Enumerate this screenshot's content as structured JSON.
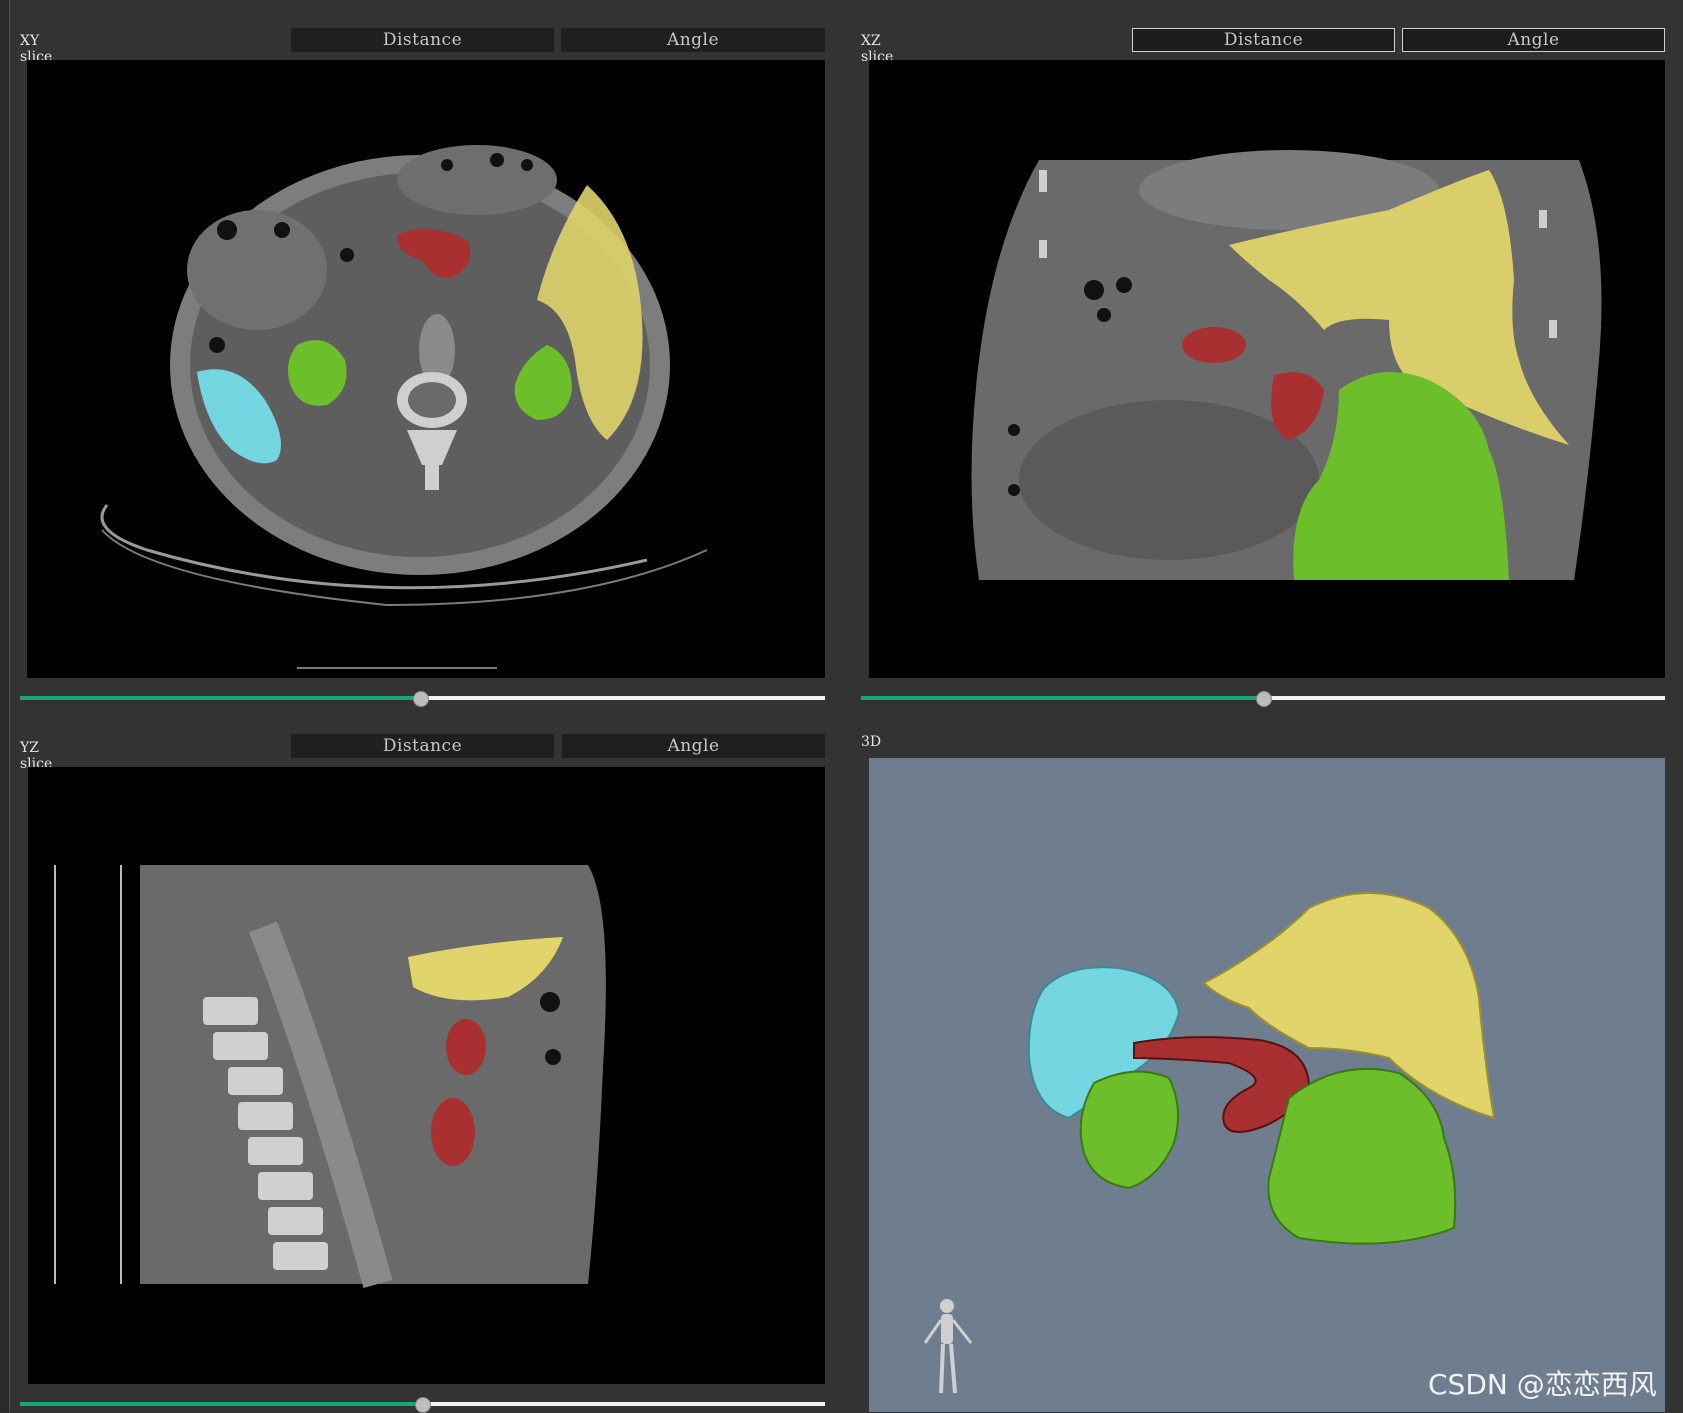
{
  "panels": {
    "xy": {
      "label": "XY slice",
      "distance": "Distance",
      "angle": "Angle",
      "slider": 0.5
    },
    "xz": {
      "label": "XZ slice",
      "distance": "Distance",
      "angle": "Angle",
      "slider": 0.5
    },
    "yz": {
      "label": "YZ slice",
      "distance": "Distance",
      "angle": "Angle",
      "slider": 0.5
    },
    "d3": {
      "label": "3D"
    }
  },
  "colors": {
    "liver": "#e0d46a",
    "kidney": "#6cbf2a",
    "spleen": "#74d6e0",
    "vessel": "#a83030",
    "bone": "#d8d8d8",
    "body": "#6a6a6a",
    "bg3d": "#6f7e8f",
    "slider_fill": "#17a874"
  },
  "watermark": "CSDN @恋恋西风"
}
